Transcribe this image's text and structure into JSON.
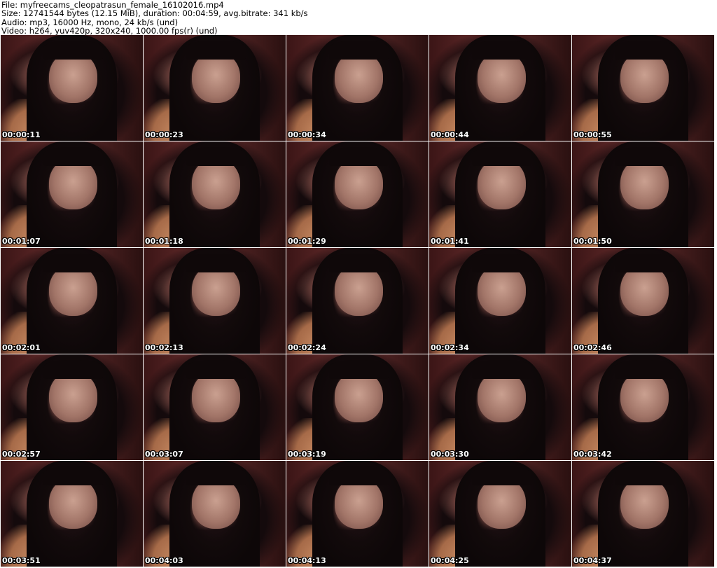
{
  "header": {
    "line1": "File: myfreecams_cleopatrasun_female_16102016.mp4",
    "line2": "Size: 12741544 bytes (12.15 MiB), duration: 00:04:59, avg.bitrate: 341 kb/s",
    "line3": "Audio: mp3, 16000 Hz, mono, 24 kb/s (und)",
    "line4": "Video: h264, yuv420p, 320x240, 1000.00 fps(r) (und)"
  },
  "thumbnails": [
    "00:00:11",
    "00:00:23",
    "00:00:34",
    "00:00:44",
    "00:00:55",
    "00:01:07",
    "00:01:18",
    "00:01:29",
    "00:01:41",
    "00:01:50",
    "00:02:01",
    "00:02:13",
    "00:02:24",
    "00:02:34",
    "00:02:46",
    "00:02:57",
    "00:03:07",
    "00:03:19",
    "00:03:30",
    "00:03:42",
    "00:03:51",
    "00:04:03",
    "00:04:13",
    "00:04:25",
    "00:04:37"
  ]
}
